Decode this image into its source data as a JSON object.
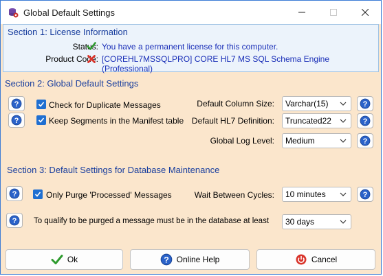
{
  "window": {
    "title": "Global Default Settings",
    "app_icon": "database-gear-icon",
    "minimize_icon": "minimize-icon",
    "maximize_icon": "maximize-icon",
    "close_icon": "close-icon"
  },
  "section1": {
    "title": "Section 1: License Information",
    "status_label": "Status:",
    "status_value": "You have a permanent license for this computer.",
    "status_icon": "green-check-icon",
    "product_label": "Product Code:",
    "product_value": "[COREHL7MSSQLPRO] CORE HL7 MS SQL Schema Engine (Professional)",
    "product_icon": "red-x-icon"
  },
  "section2": {
    "title": "Section 2: Global Default Settings",
    "check_duplicates_label": "Check for Duplicate Messages",
    "check_duplicates_checked": true,
    "keep_segments_label": "Keep Segments in the Manifest table",
    "keep_segments_checked": true,
    "column_size_label": "Default Column Size:",
    "column_size_value": "Varchar(15)",
    "hl7_definition_label": "Default HL7 Definition:",
    "hl7_definition_value": "Truncated22",
    "log_level_label": "Global Log Level:",
    "log_level_value": "Medium"
  },
  "section3": {
    "title": "Section 3: Default Settings for Database Maintenance",
    "only_purge_label": "Only Purge 'Processed' Messages",
    "only_purge_checked": true,
    "wait_cycles_label": "Wait Between Cycles:",
    "wait_cycles_value": "10 minutes",
    "purge_age_label": "To qualify to be purged a message must be in the database at least",
    "purge_age_value": "30 days"
  },
  "buttons": {
    "ok_label": "Ok",
    "help_label": "Online Help",
    "cancel_label": "Cancel"
  },
  "colors": {
    "section_title": "#1a3f9e",
    "link_text": "#1a2fb8",
    "panel_bg": "#fbe6cc",
    "checkbox": "#1f6fd1"
  }
}
